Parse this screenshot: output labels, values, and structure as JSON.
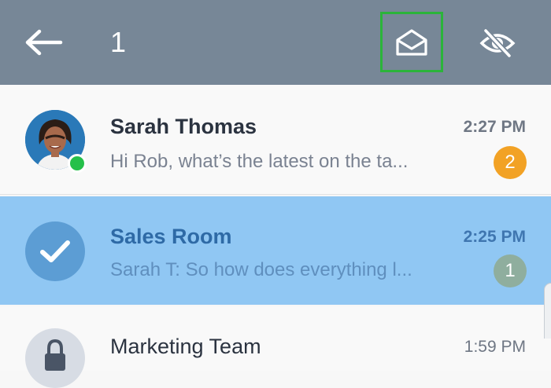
{
  "toolbar": {
    "selected_count": "1",
    "back_icon": "arrow-left-icon",
    "mark_read_icon": "open-envelope-icon",
    "hide_icon": "eye-off-icon",
    "background": "#778797",
    "highlight": "#2bb43a"
  },
  "conversations": [
    {
      "name": "Sarah Thomas",
      "preview": "Hi Rob, what’s the latest on the ta...",
      "time": "2:27 PM",
      "unread": "2",
      "avatar": "profile-photo",
      "presence": "online",
      "selected": false
    },
    {
      "name": "Sales Room",
      "preview": "Sarah T: So how does everything l...",
      "time": "2:25 PM",
      "unread": "1",
      "avatar": "checkmark-icon",
      "selected": true
    },
    {
      "name": "Marketing Team",
      "time": "1:59 PM",
      "avatar": "lock-icon",
      "selected": false
    }
  ],
  "colors": {
    "selected_row": "#90c7f3",
    "unread_badge": "#f2a225",
    "presence_online": "#25c04a"
  }
}
